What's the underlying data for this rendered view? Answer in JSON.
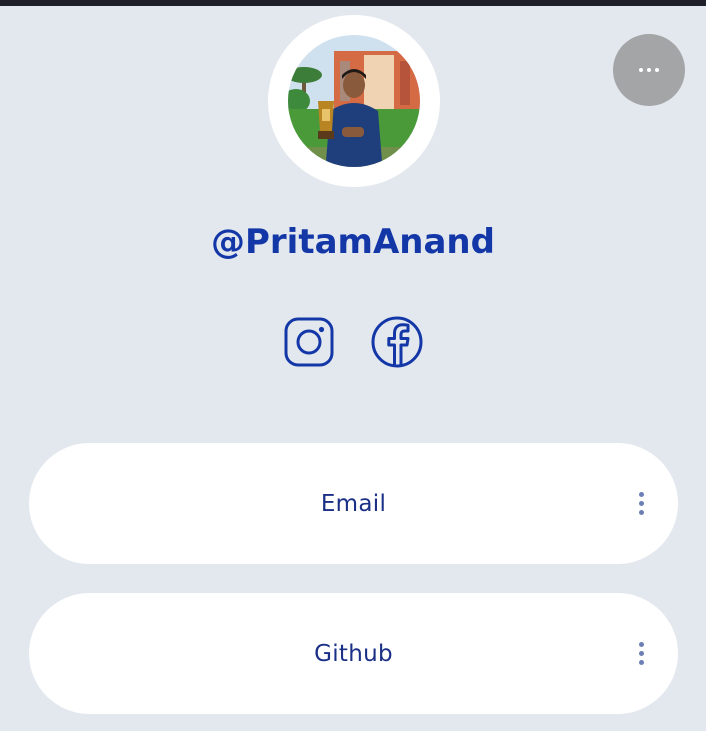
{
  "profile": {
    "username": "@PritamAnand",
    "avatar_alt": "profile-photo"
  },
  "header": {
    "more_icon": "more-horizontal-icon"
  },
  "socials": [
    {
      "name": "instagram",
      "icon": "instagram-icon"
    },
    {
      "name": "facebook",
      "icon": "facebook-icon"
    }
  ],
  "links": [
    {
      "label": "Email",
      "menu_icon": "kebab-menu-icon"
    },
    {
      "label": "Github",
      "menu_icon": "kebab-menu-icon"
    }
  ],
  "colors": {
    "background": "#e3e8ee",
    "accent": "#1437a8",
    "card": "#ffffff",
    "more_button": "#a3a5a7"
  }
}
